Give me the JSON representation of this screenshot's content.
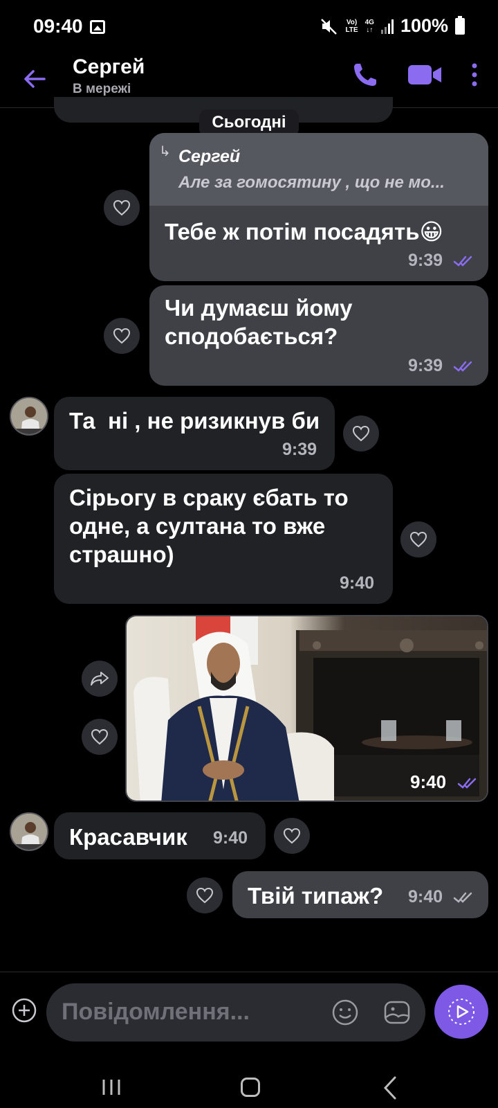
{
  "status_bar": {
    "time": "09:40",
    "network_top": "Vo)",
    "network_bottom": "LTE",
    "network2_top": "4G",
    "network2_bottom": "↓↑",
    "battery": "100%"
  },
  "header": {
    "contact_name": "Сергей",
    "contact_status": "В мережі"
  },
  "date_separator": "Сьогодні",
  "messages": [
    {
      "direction": "out",
      "reply": {
        "author": "Сергей",
        "text": "Але за гомосятину , що не мо..."
      },
      "text": "Тебе ж потім посадять😀",
      "time": "9:39",
      "status": "read"
    },
    {
      "direction": "out",
      "text_lines": [
        "Чи думаєш йому",
        "сподобається?"
      ],
      "time": "9:39",
      "status": "read"
    },
    {
      "direction": "in",
      "text": "Та  ні , не ризикнув би",
      "time": "9:39"
    },
    {
      "direction": "in",
      "text_lines": [
        "Сірьогу в сраку єбать то",
        "одне, а султана то вже",
        "страшно)"
      ],
      "time": "9:40"
    },
    {
      "direction": "out",
      "type": "image",
      "image_description": "man in traditional white and black robe seated in white armchair",
      "time": "9:40",
      "status": "read"
    },
    {
      "direction": "in",
      "text": "Красавчик",
      "time": "9:40"
    },
    {
      "direction": "out",
      "text": "Твій типаж?",
      "time": "9:40",
      "status": "delivered"
    }
  ],
  "composer": {
    "placeholder": "Повідомлення..."
  },
  "colors": {
    "accent": "#7d59e6",
    "incoming_bubble": "#212226",
    "outgoing_bubble": "#3f4147",
    "background": "#000000"
  }
}
